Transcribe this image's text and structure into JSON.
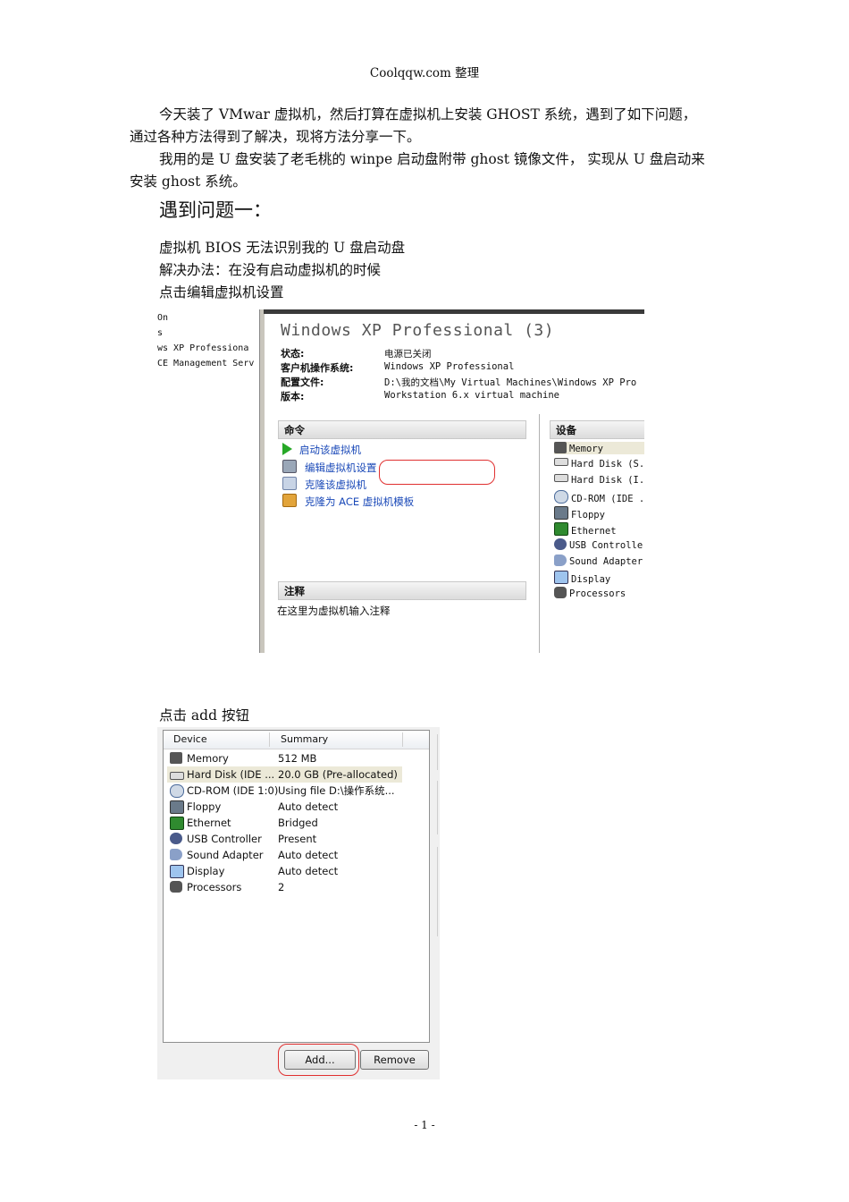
{
  "header": "Coolqqw.com 整理",
  "paragraphs": {
    "p1a": "今天装了 VMwar 虚拟机，然后打算在虚拟机上安装 GHOST 系统，遇到了如下问题，",
    "p1b": "通过各种方法得到了解决，现将方法分享一下。",
    "p2a": "我用的是 U 盘安装了老毛桃的 winpe 启动盘附带 ghost 镜像文件，  实现从 U 盘启动来",
    "p2b": "安装 ghost 系统。"
  },
  "heading1": "遇到问题一：",
  "lines": {
    "l1": "虚拟机 BIOS 无法识别我的 U 盘启动盘",
    "l2": "解决办法：在没有启动虚拟机的时候",
    "l3": "点击编辑虚拟机设置",
    "l4": "点击 add 按钮"
  },
  "shot1": {
    "left_items": [
      "On",
      "s",
      "ws XP Professiona",
      "CE Management Serv"
    ],
    "title": "Windows XP Professional (3)",
    "props": [
      {
        "key": "状态:",
        "value": "电源已关闭"
      },
      {
        "key": "客户机操作系统:",
        "value": "Windows XP Professional"
      },
      {
        "key": "配置文件:",
        "value": "D:\\我的文档\\My Virtual Machines\\Windows XP Pro"
      },
      {
        "key": "版本:",
        "value": "Workstation 6.x virtual machine"
      }
    ],
    "commands_header": "命令",
    "commands": [
      "启动该虚拟机",
      "编辑虚拟机设置",
      "克隆该虚拟机",
      "克隆为 ACE 虚拟机模板"
    ],
    "notes_header": "注释",
    "notes_text": "在这里为虚拟机输入注释",
    "devices_header": "设备",
    "devices": [
      "Memory",
      "Hard Disk (S.",
      "Hard Disk (I.",
      "CD-ROM (IDE .",
      "Floppy",
      "Ethernet",
      "USB Controlle",
      "Sound Adapter",
      "Display",
      "Processors"
    ]
  },
  "shot2": {
    "col_device": "Device",
    "col_summary": "Summary",
    "rows": [
      {
        "device": "Memory",
        "summary": "512 MB"
      },
      {
        "device": "Hard Disk (IDE ...",
        "summary": "20.0 GB (Pre-allocated)"
      },
      {
        "device": "CD-ROM (IDE 1:0)",
        "summary": "Using file D:\\操作系统..."
      },
      {
        "device": "Floppy",
        "summary": "Auto detect"
      },
      {
        "device": "Ethernet",
        "summary": "Bridged"
      },
      {
        "device": "USB Controller",
        "summary": "Present"
      },
      {
        "device": "Sound Adapter",
        "summary": "Auto detect"
      },
      {
        "device": "Display",
        "summary": "Auto detect"
      },
      {
        "device": "Processors",
        "summary": "2"
      }
    ],
    "add_button": "Add...",
    "remove_button": "Remove"
  },
  "footer": "- 1 -",
  "colors": {
    "link": "#1a49b8",
    "highlight_ring": "#e03030",
    "selected_row": "#ece9d8"
  }
}
